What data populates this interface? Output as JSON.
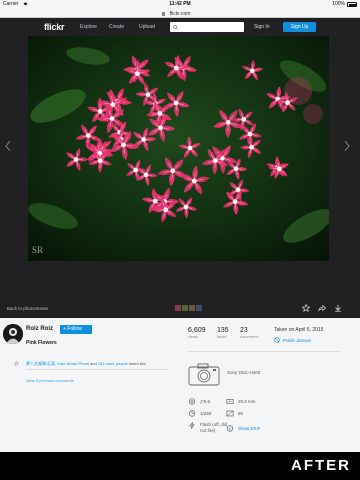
{
  "status_bar": {
    "carrier": "Carrier",
    "time": "11:42 PM",
    "battery": "100%"
  },
  "browser": {
    "url": "flickr.com"
  },
  "nav": {
    "logo": "flickr",
    "links": [
      "Explore",
      "Create",
      "Upload"
    ],
    "search_placeholder": "",
    "sign_in": "Sign In",
    "sign_up": "Sign Up"
  },
  "photo": {
    "watermark": "SR",
    "back_link": "Back to photostream"
  },
  "owner": {
    "name": "Roiz Roiz",
    "follow_label": "+ Follow"
  },
  "title": "Pink Flowers",
  "faves": {
    "people": "夢人文娛樂/石某, Kian-Seran Photo",
    "and": " and ",
    "more": "133 more people",
    "suffix": " faved this"
  },
  "comments_link": "View 3 previous comments",
  "stats": [
    {
      "value": "6,609",
      "label": "views"
    },
    {
      "value": "135",
      "label": "faves"
    },
    {
      "value": "23",
      "label": "comments"
    }
  ],
  "taken_on": "Taken on April 5, 2015",
  "license": "Public domain",
  "camera": {
    "model": "Sony DSC-H400"
  },
  "exif": {
    "aperture": "ƒ/5.6",
    "focal_length": "25.0 mm",
    "shutter": "1/250",
    "iso": "80",
    "flash": "Flash (off, did not fire)",
    "show_exif": "Show EXIF"
  },
  "colors": {
    "accent": "#128fdc",
    "header_bg": "#212124",
    "petal": "#e6336f"
  },
  "after_label": "AFTER"
}
